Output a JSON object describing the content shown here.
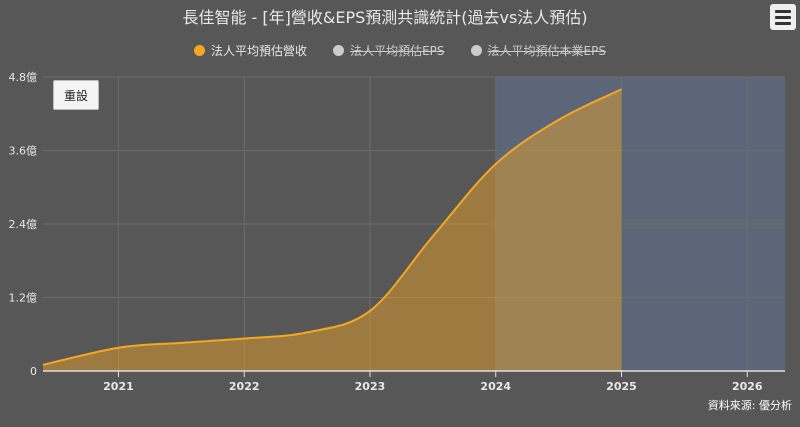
{
  "title": "長佳智能 - [年]營收&EPS預測共識統計(過去vs法人預估)",
  "menu_icon": "hamburger-menu-icon",
  "reset_label": "重設",
  "source_label": "資料來源: 優分析",
  "legend": [
    {
      "label": "法人平均預估營收",
      "color": "#f5a623",
      "hidden": false
    },
    {
      "label": "法人平均預估EPS",
      "color": "#cccccc",
      "hidden": true
    },
    {
      "label": "法人平均預估本業EPS",
      "color": "#cccccc",
      "hidden": true
    }
  ],
  "chart_data": {
    "type": "area",
    "title": "長佳智能 - [年]營收&EPS預測共識統計(過去vs法人預估)",
    "xlabel": "",
    "ylabel": "",
    "x_ticks": [
      "2021",
      "2022",
      "2023",
      "2024",
      "2025",
      "2026"
    ],
    "y_ticks": [
      "0",
      "1.2億",
      "2.4億",
      "3.6億",
      "4.8億"
    ],
    "ylim": [
      0,
      4.8
    ],
    "y_unit": "億",
    "xlim": [
      2020.4,
      2026.3
    ],
    "series": [
      {
        "name": "法人平均預估營收",
        "color": "#f5a623",
        "x": [
          2020.4,
          2021,
          2021.5,
          2022,
          2022.5,
          2023,
          2023.5,
          2024,
          2024.5,
          2025
        ],
        "values": [
          0.1,
          0.38,
          0.46,
          0.53,
          0.63,
          0.98,
          2.2,
          3.38,
          4.1,
          4.6
        ]
      }
    ],
    "forecast_band": {
      "from": 2024,
      "to": 2026.3,
      "color": "#5c6679"
    },
    "grid": true,
    "legend_position": "top-center"
  }
}
